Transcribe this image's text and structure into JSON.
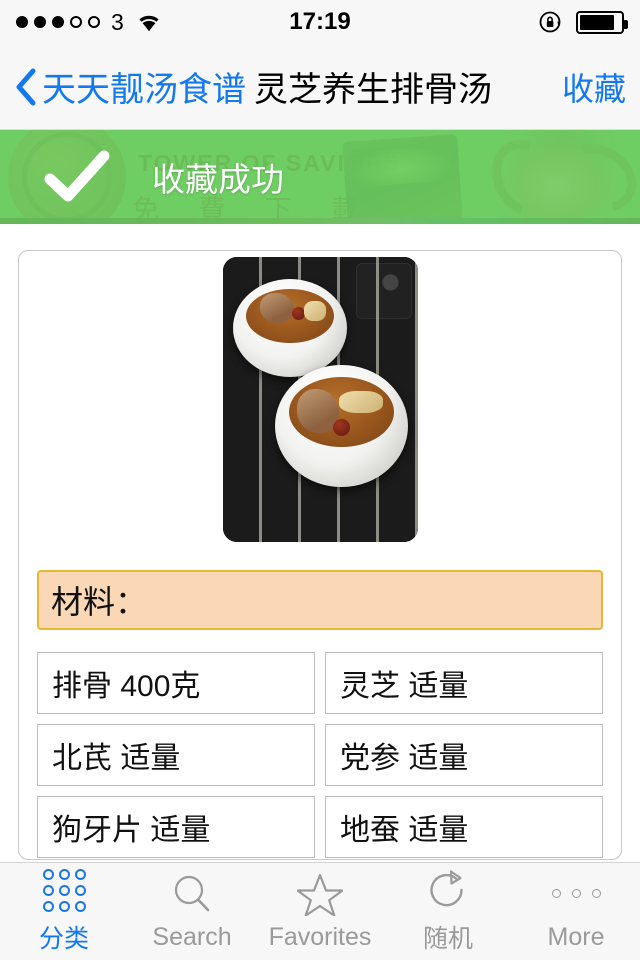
{
  "status_bar": {
    "signal_dots_filled": 3,
    "signal_dots_total": 5,
    "carrier": "3",
    "wifi_icon": "wifi-icon",
    "time": "17:19",
    "rotation_lock_icon": "rotation-lock-icon",
    "battery_icon": "battery-icon",
    "battery_level_percent": 88
  },
  "nav": {
    "back_icon": "chevron-left-icon",
    "back_label": "天天靓汤食谱",
    "title": "灵芝养生排骨汤",
    "action_label": "收藏",
    "accent_color": "#1479ef"
  },
  "toast": {
    "check_icon": "check-icon",
    "message": "收藏成功",
    "background_color": "#6ece62"
  },
  "ad_banner": {
    "title": "TOWER OF SAVIORS",
    "subtitle": "免 費 下 載"
  },
  "recipe": {
    "photo_alt": "灵芝养生排骨汤",
    "section_title": "材料：",
    "section_background_color": "#fad8b6",
    "section_border_color": "#e8b832",
    "ingredients": [
      "排骨 400克",
      "灵芝 适量",
      "北芪 适量",
      "党参 适量",
      "狗牙片 适量",
      "地蚕 适量"
    ]
  },
  "tabbar": {
    "items": [
      {
        "label": "分类",
        "icon": "grid-icon",
        "active": true
      },
      {
        "label": "Search",
        "icon": "search-icon",
        "active": false
      },
      {
        "label": "Favorites",
        "icon": "star-icon",
        "active": false
      },
      {
        "label": "随机",
        "icon": "refresh-icon",
        "active": false
      },
      {
        "label": "More",
        "icon": "more-dots-icon",
        "active": false
      }
    ],
    "active_color": "#1479ef",
    "inactive_color": "#9a9a9a"
  }
}
